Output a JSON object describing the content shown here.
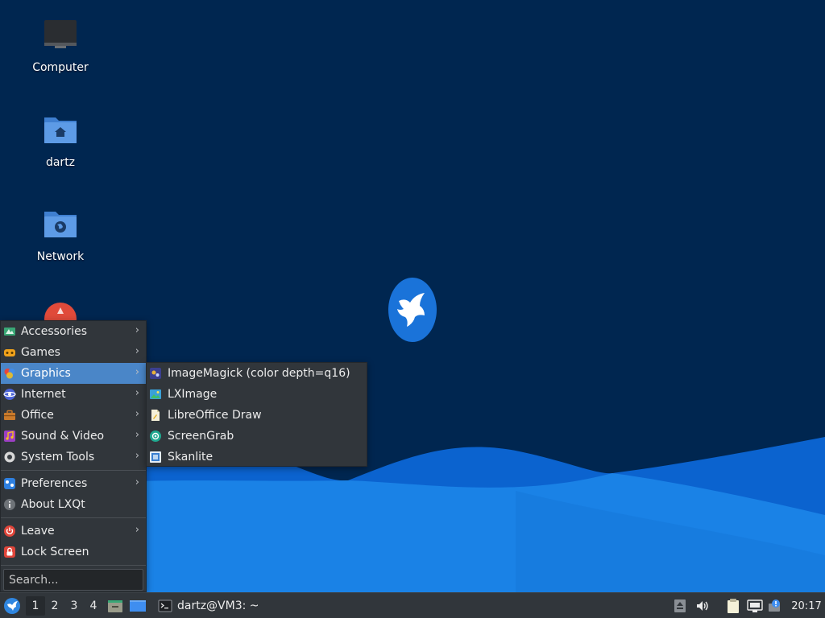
{
  "desktop": {
    "icons": [
      {
        "label": "Computer"
      },
      {
        "label": "dartz"
      },
      {
        "label": "Network"
      }
    ]
  },
  "main_menu": {
    "items": [
      {
        "label": "Accessories",
        "icon": "accessories-icon",
        "has_submenu": true
      },
      {
        "label": "Games",
        "icon": "games-icon",
        "has_submenu": true
      },
      {
        "label": "Graphics",
        "icon": "graphics-icon",
        "has_submenu": true,
        "active": true
      },
      {
        "label": "Internet",
        "icon": "internet-icon",
        "has_submenu": true
      },
      {
        "label": "Office",
        "icon": "office-icon",
        "has_submenu": true
      },
      {
        "label": "Sound & Video",
        "icon": "sound-video-icon",
        "has_submenu": true
      },
      {
        "label": "System Tools",
        "icon": "system-tools-icon",
        "has_submenu": true
      },
      {
        "label": "Preferences",
        "icon": "preferences-icon",
        "has_submenu": true
      },
      {
        "label": "About LXQt",
        "icon": "info-icon",
        "has_submenu": false
      },
      {
        "label": "Leave",
        "icon": "power-icon",
        "has_submenu": true
      },
      {
        "label": "Lock Screen",
        "icon": "lock-icon",
        "has_submenu": false
      }
    ],
    "search_placeholder": "Search..."
  },
  "graphics_submenu": {
    "items": [
      {
        "label": "ImageMagick (color depth=q16)",
        "icon": "imagemagick-icon"
      },
      {
        "label": "LXImage",
        "icon": "lximage-icon"
      },
      {
        "label": "LibreOffice Draw",
        "icon": "libreoffice-draw-icon"
      },
      {
        "label": "ScreenGrab",
        "icon": "screengrab-icon"
      },
      {
        "label": "Skanlite",
        "icon": "skanlite-icon"
      }
    ]
  },
  "taskbar": {
    "workspaces": [
      "1",
      "2",
      "3",
      "4"
    ],
    "active_workspace": "1",
    "task_title": "dartz@VM3: ~",
    "clock": "20:17"
  },
  "colors": {
    "desktop_bg": "#002650",
    "menu_bg": "#31363b",
    "menu_highlight": "#4a86c8",
    "wave_light": "#1e88e5",
    "wave_dark": "#0a5fc8"
  }
}
